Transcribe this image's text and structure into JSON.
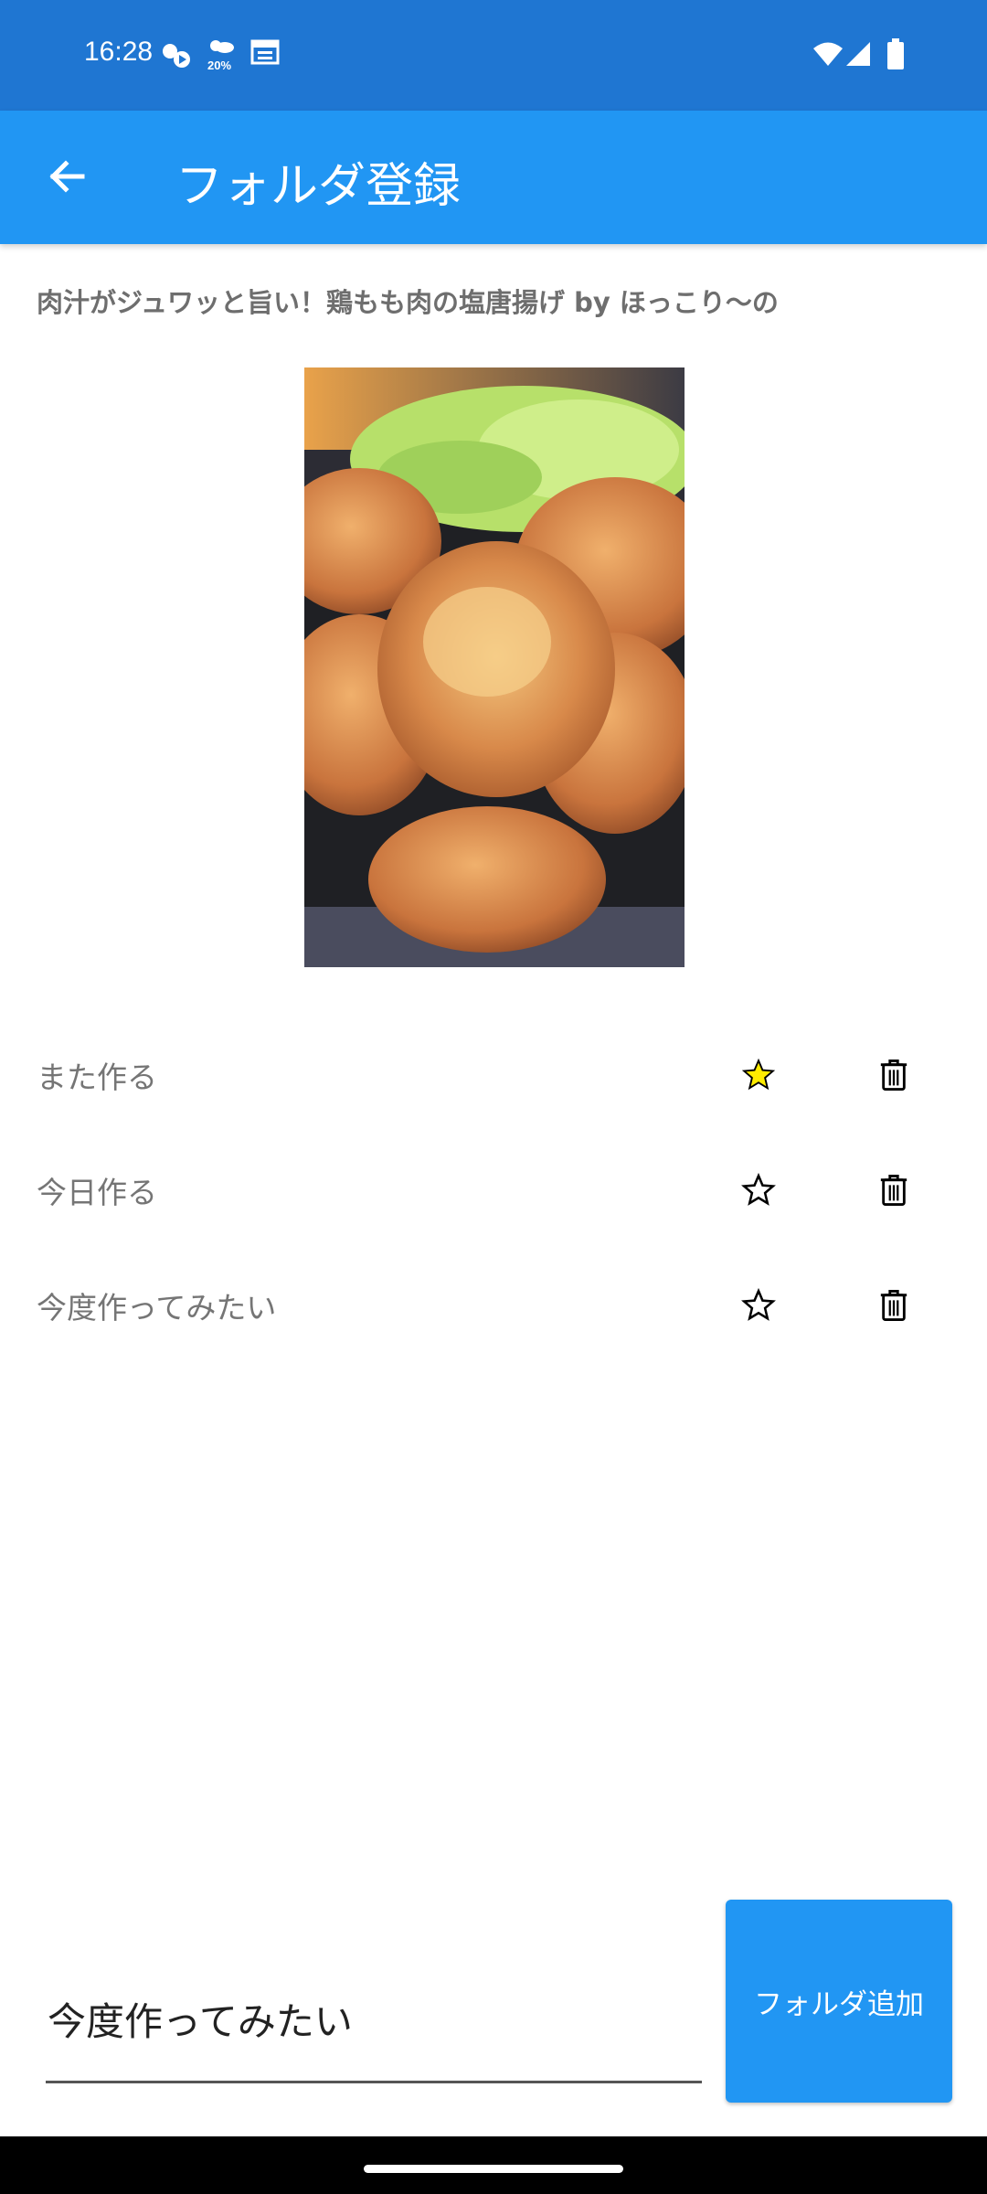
{
  "status_bar": {
    "time": "16:28",
    "icons": [
      "weather-play-icon",
      "weather-20-icon",
      "calendar-icon",
      "wifi-icon",
      "cellular-icon",
      "battery-icon"
    ],
    "weather_percent": "20%"
  },
  "app_bar": {
    "back_icon": "arrow-left-icon",
    "title": "フォルダ登録",
    "color": "#2196f3"
  },
  "recipe": {
    "title": "肉汁がジュワッと旨い！鶏もも肉の塩唐揚げ by ほっこり〜の",
    "image": "fried-chicken-photo"
  },
  "folders": [
    {
      "label": "また作る",
      "starred": true
    },
    {
      "label": "今日作る",
      "starred": false
    },
    {
      "label": "今度作ってみたい",
      "starred": false
    }
  ],
  "new_folder": {
    "value": "今度作ってみたい",
    "button_label": "フォルダ追加"
  },
  "colors": {
    "status_bar": "#1f76d2",
    "accent": "#2196f3",
    "star_active": "#ffeb00"
  }
}
